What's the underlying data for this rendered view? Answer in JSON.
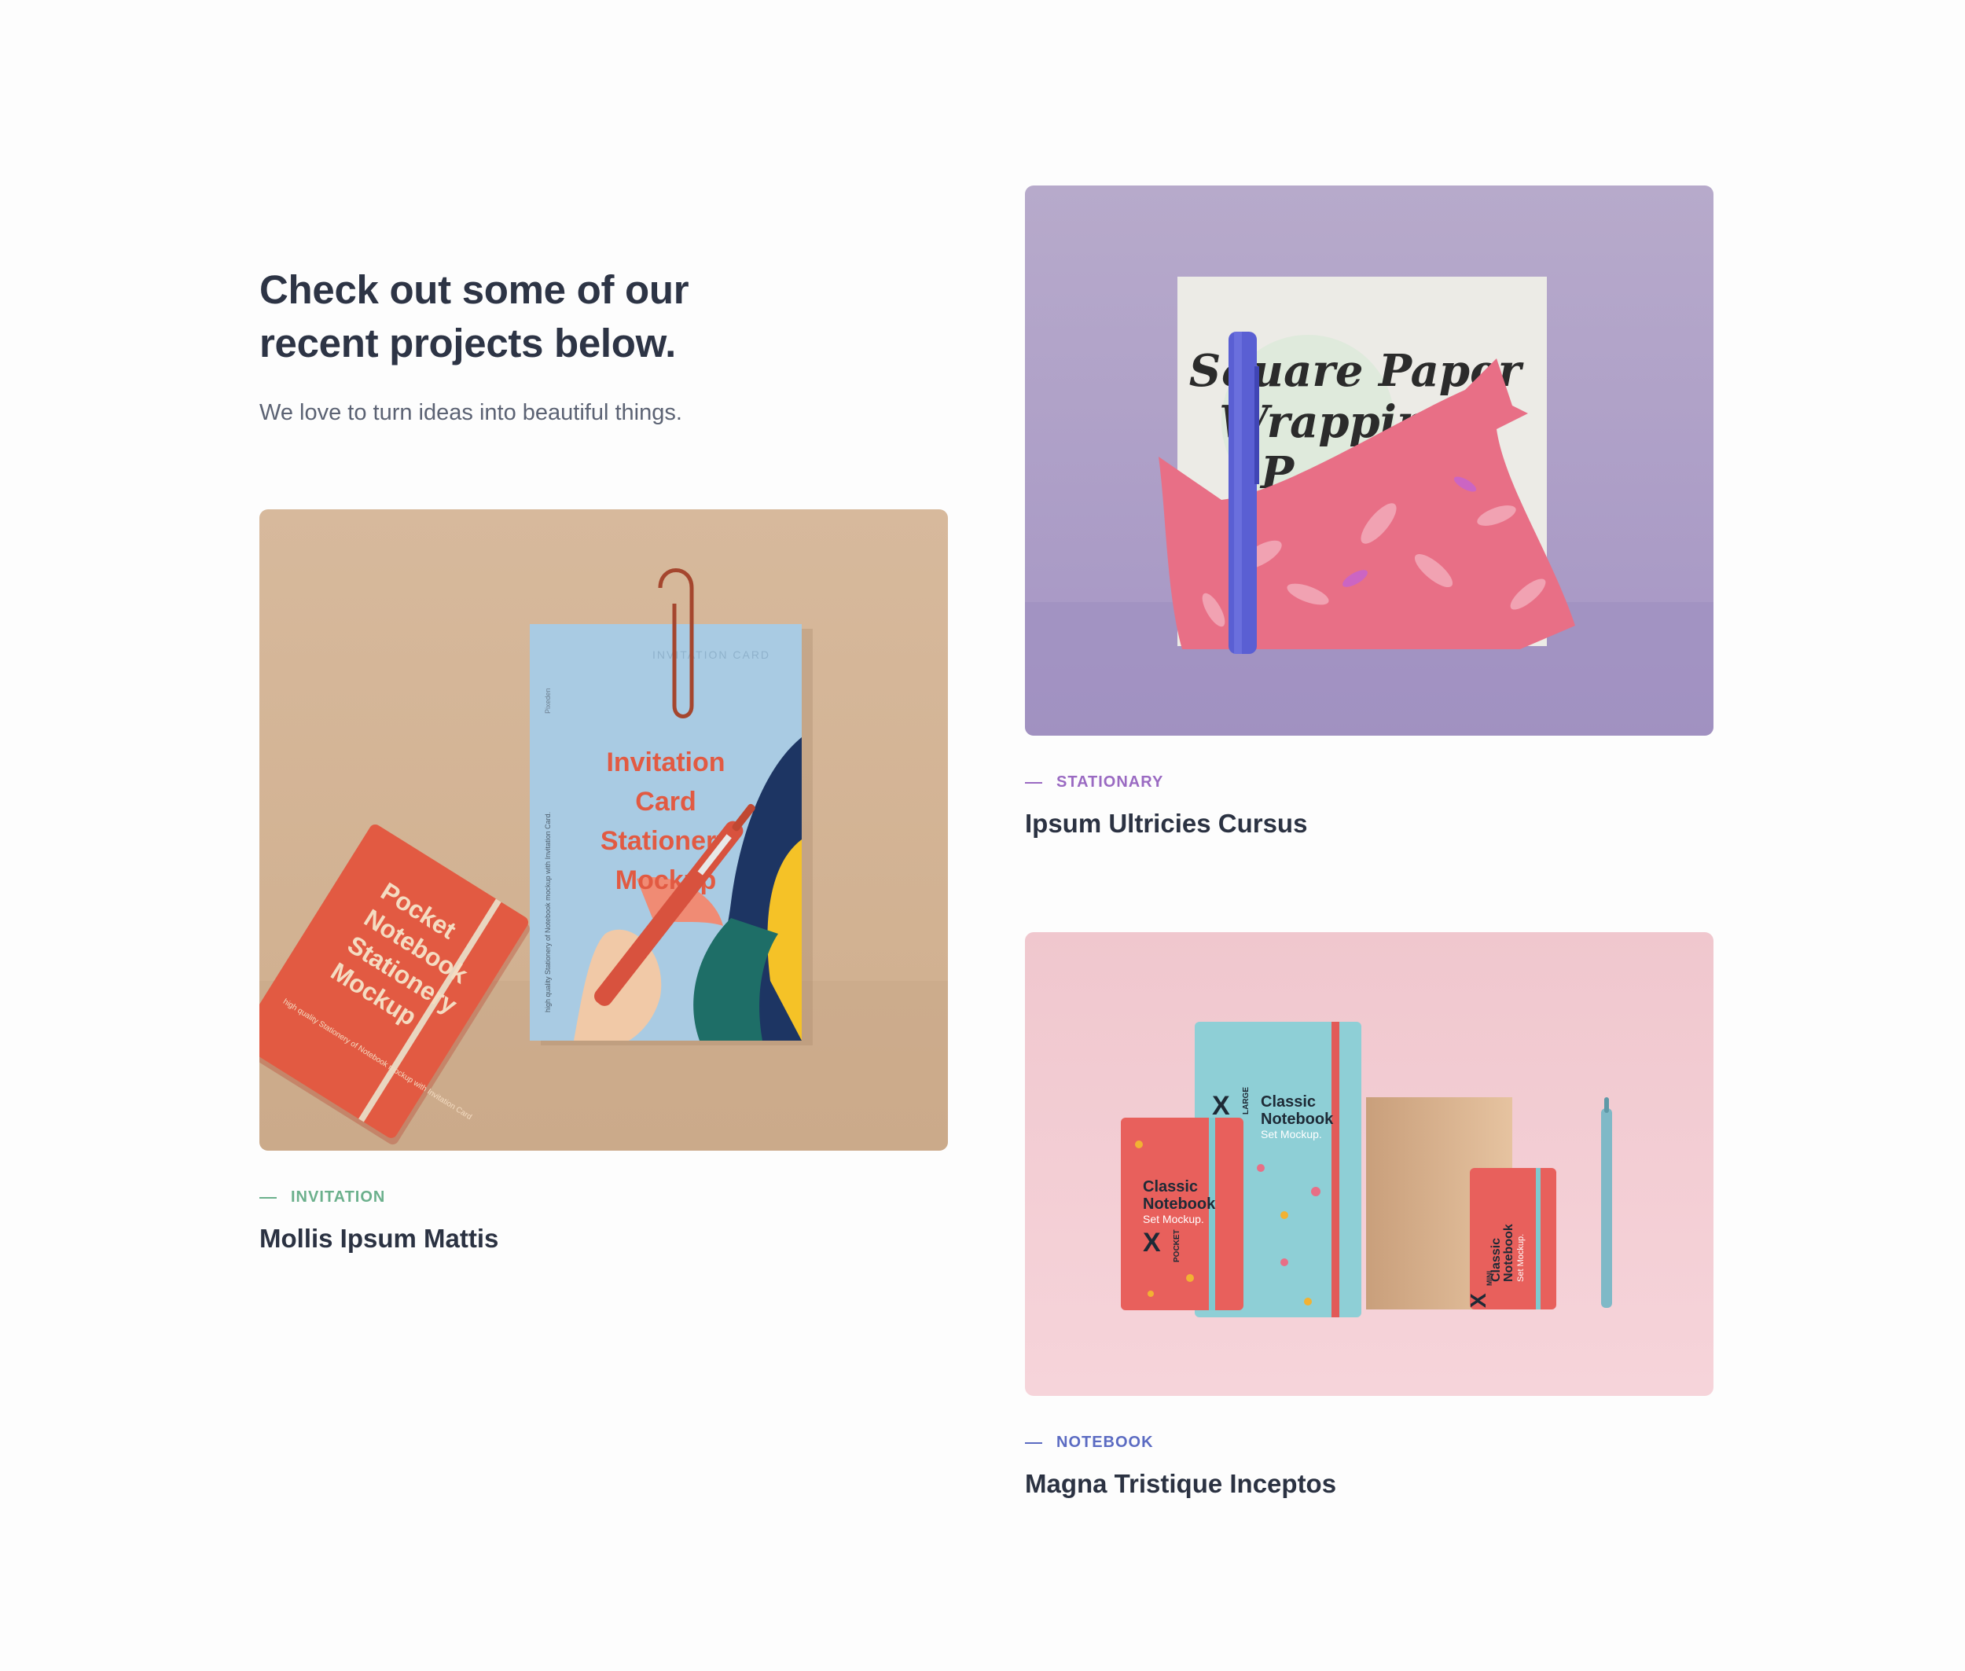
{
  "intro": {
    "headline_line1": "Check out some of our",
    "headline_line2": "recent projects below.",
    "subhead": "We love to turn ideas into beautiful things."
  },
  "projects": [
    {
      "category": "INVITATION",
      "title": "Mollis Ipsum Mattis",
      "accent": "#6bb08c",
      "image": {
        "notebook_text": [
          "Pocket",
          "Notebook",
          "Stationery",
          "Mockup"
        ],
        "card_text": [
          "Invitation",
          "Card",
          "Stationery",
          "Mockup"
        ],
        "card_header": "INVITATION CARD",
        "card_brand": "Pixeden",
        "card_side": "high quality Stationery of Notebook mockup with Invitation Card.",
        "notebook_side": "high quality Stationery of Notebook mockup with Invitation Card"
      }
    },
    {
      "category": "STATIONARY",
      "title": "Ipsum Ultricies Cursus",
      "accent": "#9a6ac2",
      "image": {
        "script_text": [
          "Square Paper",
          "Wrapping",
          "P"
        ]
      }
    },
    {
      "category": "NOTEBOOK",
      "title": "Magna Tristique Inceptos",
      "accent": "#5b6bc2",
      "image": {
        "large_notebook": [
          "X",
          "LARGE",
          "Classic",
          "Notebook",
          "Set Mockup."
        ],
        "pocket_notebook": [
          "Classic",
          "Notebook",
          "Set Mockup.",
          "X",
          "POCKET"
        ],
        "mini_notebook": [
          "Classic",
          "Notebook",
          "Set Mockup.",
          "X",
          "MINI"
        ]
      }
    }
  ]
}
